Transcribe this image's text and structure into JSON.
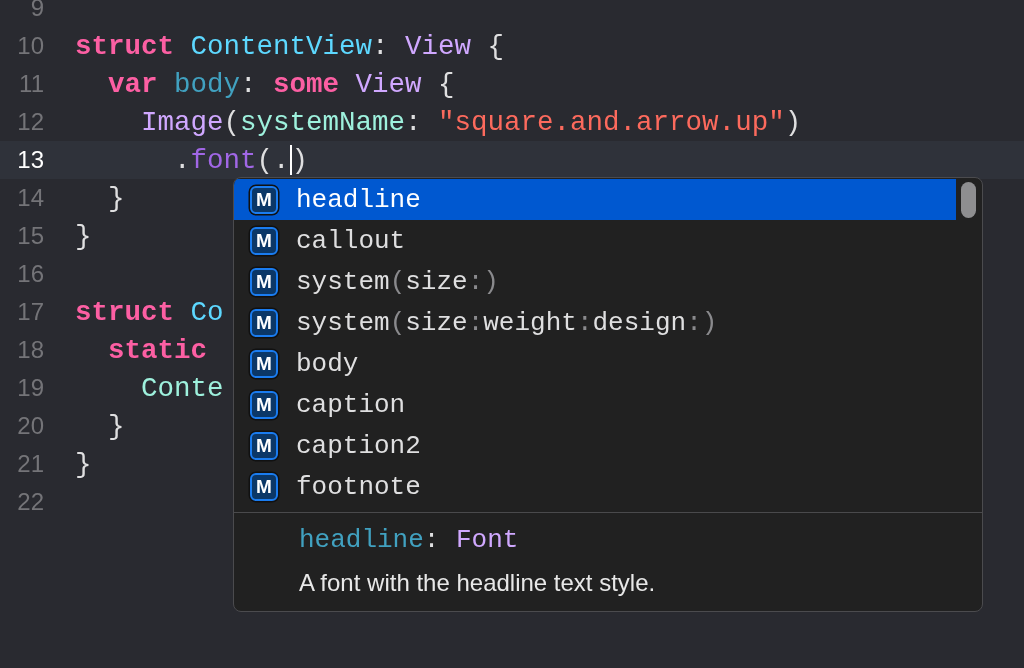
{
  "editor": {
    "lines": [
      {
        "number": "9",
        "current": false
      },
      {
        "number": "10",
        "current": false,
        "tokens": [
          {
            "kind": "keyword",
            "text": "struct"
          },
          {
            "kind": "decl",
            "text": "ContentView"
          },
          {
            "kind": "plain",
            "text": ":"
          },
          {
            "kind": "type",
            "text": "View"
          },
          {
            "kind": "plain",
            "text": "{"
          }
        ],
        "children": [
          {
            "number": "11",
            "current": false,
            "tokens": [
              {
                "kind": "keyword",
                "text": "var"
              },
              {
                "kind": "property",
                "text": "body"
              },
              {
                "kind": "plain",
                "text": ":"
              },
              {
                "kind": "keyword",
                "text": "some"
              },
              {
                "kind": "type",
                "text": "View"
              },
              {
                "kind": "plain",
                "text": "{"
              }
            ],
            "children": [
              {
                "number": "12",
                "current": false,
                "tokens": [
                  {
                    "kind": "type",
                    "text": "Image"
                  },
                  {
                    "kind": "plain",
                    "text": "("
                  },
                  {
                    "kind": "label",
                    "text": "systemName"
                  },
                  {
                    "kind": "plain",
                    "text": ":"
                  },
                  {
                    "kind": "string",
                    "text": "\"square.and.arrow.up\""
                  },
                  {
                    "kind": "plain",
                    "text": ")"
                  }
                ],
                "children": [
                  {
                    "number": "13",
                    "current": true,
                    "tokens": [
                      {
                        "kind": "plain",
                        "text": "."
                      },
                      {
                        "kind": "method",
                        "text": "font"
                      },
                      {
                        "kind": "plain",
                        "text": "(."
                      },
                      {
                        "kind": "cursor"
                      },
                      {
                        "kind": "plain",
                        "text": ")"
                      }
                    ]
                  }
                ]
              }
            ]
          },
          {
            "number": "14",
            "current": false,
            "tokens": [
              {
                "kind": "plain",
                "text": "}"
              }
            ]
          }
        ]
      },
      {
        "number": "15",
        "current": false,
        "tokens": [
          {
            "kind": "plain",
            "text": "}"
          }
        ]
      },
      {
        "number": "16",
        "current": false
      },
      {
        "number": "17",
        "current": false,
        "tokens": [
          {
            "kind": "keyword",
            "text": "struct"
          },
          {
            "kind": "decl",
            "text": "Co"
          }
        ],
        "children": [
          {
            "number": "18",
            "current": false,
            "tokens": [
              {
                "kind": "keyword",
                "text": "static"
              }
            ],
            "children": [
              {
                "number": "19",
                "current": false,
                "tokens": [
                  {
                    "kind": "label",
                    "text": "Conte"
                  }
                ]
              }
            ]
          },
          {
            "number": "20",
            "current": false,
            "tokens": [
              {
                "kind": "plain",
                "text": "}"
              }
            ]
          }
        ]
      },
      {
        "number": "21",
        "current": false,
        "tokens": [
          {
            "kind": "plain",
            "text": "}"
          }
        ]
      },
      {
        "number": "22",
        "current": false
      }
    ]
  },
  "completion": {
    "items": [
      {
        "badge": "M",
        "selected": true,
        "segments": [
          {
            "kind": "name",
            "text": "headline"
          }
        ]
      },
      {
        "badge": "M",
        "selected": false,
        "segments": [
          {
            "kind": "name",
            "text": "callout"
          }
        ]
      },
      {
        "badge": "M",
        "selected": false,
        "segments": [
          {
            "kind": "name",
            "text": "system"
          },
          {
            "kind": "punct",
            "text": "("
          },
          {
            "kind": "name",
            "text": "size"
          },
          {
            "kind": "punct",
            "text": ":)"
          }
        ]
      },
      {
        "badge": "M",
        "selected": false,
        "segments": [
          {
            "kind": "name",
            "text": "system"
          },
          {
            "kind": "punct",
            "text": "("
          },
          {
            "kind": "name",
            "text": "size"
          },
          {
            "kind": "punct",
            "text": ":"
          },
          {
            "kind": "name",
            "text": "weight"
          },
          {
            "kind": "punct",
            "text": ":"
          },
          {
            "kind": "name",
            "text": "design"
          },
          {
            "kind": "punct",
            "text": ":)"
          }
        ]
      },
      {
        "badge": "M",
        "selected": false,
        "segments": [
          {
            "kind": "name",
            "text": "body"
          }
        ]
      },
      {
        "badge": "M",
        "selected": false,
        "segments": [
          {
            "kind": "name",
            "text": "caption"
          }
        ]
      },
      {
        "badge": "M",
        "selected": false,
        "segments": [
          {
            "kind": "name",
            "text": "caption2"
          }
        ]
      },
      {
        "badge": "M",
        "selected": false,
        "segments": [
          {
            "kind": "name",
            "text": "footnote"
          }
        ]
      }
    ],
    "detail": {
      "signature": [
        {
          "kind": "property",
          "text": "headline"
        },
        {
          "kind": "plain",
          "text": ":"
        },
        {
          "kind": "type",
          "text": "Font"
        }
      ],
      "description": "A font with the headline text style."
    }
  }
}
